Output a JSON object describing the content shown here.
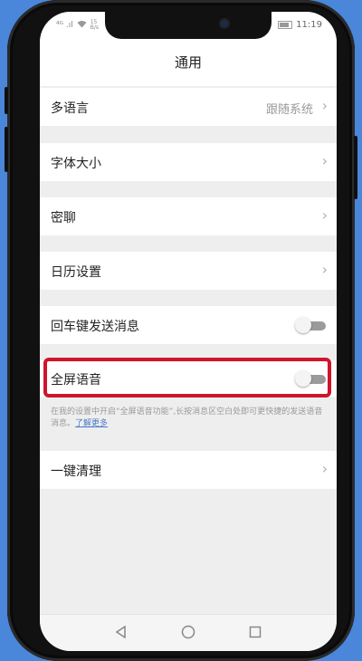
{
  "status_bar": {
    "carrier": "⁴ᴳ .ıl",
    "speed": "15 B/s",
    "battery_label": "",
    "time": "11:19"
  },
  "header": {
    "title": "通用"
  },
  "settings": {
    "language": {
      "label": "多语言",
      "value": "跟随系统"
    },
    "font_size": {
      "label": "字体大小"
    },
    "secret_chat": {
      "label": "密聊"
    },
    "calendar": {
      "label": "日历设置"
    },
    "enter_send": {
      "label": "回车键发送消息",
      "enabled": false
    },
    "fullscreen_voice": {
      "label": "全屏语音",
      "enabled": false
    },
    "fullscreen_note": "在我的设置中开启“全屏语音功能”,长按消息区空白处即可更快捷的发送语音消息。",
    "learn_more": "了解更多",
    "one_key_clear": {
      "label": "一键清理"
    }
  },
  "colors": {
    "highlight": "#d0142c",
    "link": "#4a7ac8",
    "background_frame": "#4a86d9"
  },
  "nav_bar": [
    "back-icon",
    "home-icon",
    "recents-icon"
  ]
}
